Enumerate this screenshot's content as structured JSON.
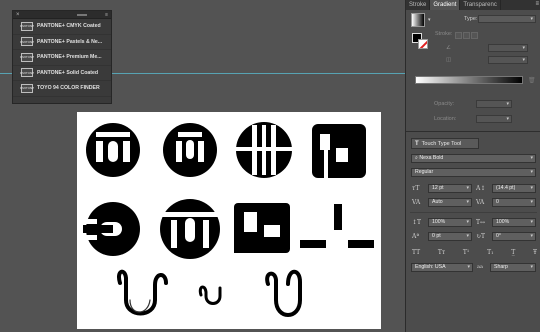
{
  "swatch_library": {
    "close_glyph": "×",
    "menu_glyph": "≡",
    "items": [
      {
        "icon": "PANTONE",
        "label": "PANTONE+ CMYK Coated"
      },
      {
        "icon": "PANTONE",
        "label": "PANTONE+ Pastels & Ne..."
      },
      {
        "icon": "PANTONE",
        "label": "PANTONE+ Premium Me..."
      },
      {
        "icon": "PANTONE",
        "label": "PANTONE+ Solid Coated"
      },
      {
        "icon": "PANTONE",
        "label": "TOYO 94 COLOR FINDER"
      }
    ]
  },
  "panel": {
    "tabs": [
      "Stroke",
      "Gradient",
      "Transparenc"
    ],
    "active_tab": "Gradient",
    "menu_glyph": "≡",
    "gradient": {
      "type_label": "Type:",
      "stroke_label": "Stroke:",
      "opacity_label": "Opacity:",
      "location_label": "Location:",
      "start_color": "#ffffff",
      "end_color": "#000000"
    }
  },
  "character": {
    "touch_type_label": "Touch Type Tool",
    "font_family": "Nexa Bold",
    "font_style": "Regular",
    "font_size": "12 pt",
    "leading": "(14.4 pt)",
    "kerning": "Auto",
    "tracking": "0",
    "vertical_scale": "100%",
    "horizontal_scale": "100%",
    "baseline_shift": "0 pt",
    "rotation": "0°",
    "language": "English: USA",
    "aa_label": "aa",
    "antialias": "Sharp"
  },
  "colors": {
    "guide": "#57a3b3",
    "artboard": "#ffffff",
    "glyph": "#000000"
  }
}
